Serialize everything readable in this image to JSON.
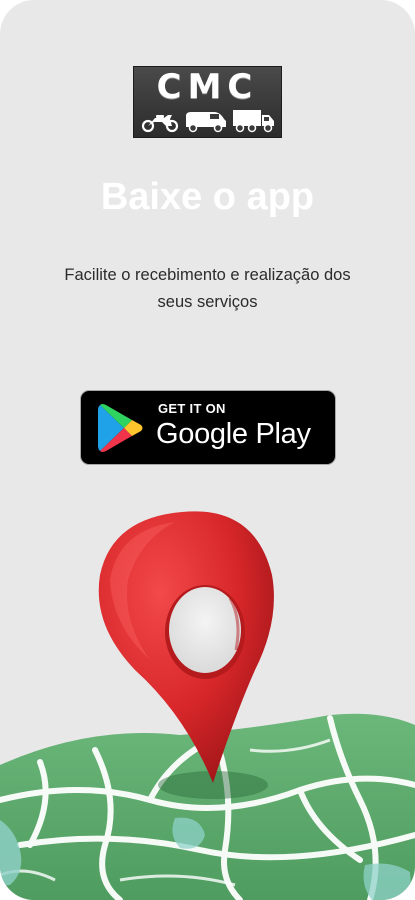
{
  "logo": {
    "text": "CMC",
    "icons": [
      "motorcycle-icon",
      "van-icon",
      "truck-icon"
    ]
  },
  "hero": {
    "title": "Baixe o app",
    "subtitle": "Facilite o recebimento e realização dos seus serviços"
  },
  "store_badge": {
    "small_text": "GET IT ON",
    "large_text": "Google Play",
    "icon": "google-play-icon"
  },
  "illustration": {
    "icons": [
      "location-pin-icon",
      "map-icon"
    ]
  },
  "colors": {
    "background": "#e8e8e9",
    "title": "#ffffff",
    "badge": "#000000",
    "pin": "#d8272a",
    "map": "#5aa86a"
  }
}
